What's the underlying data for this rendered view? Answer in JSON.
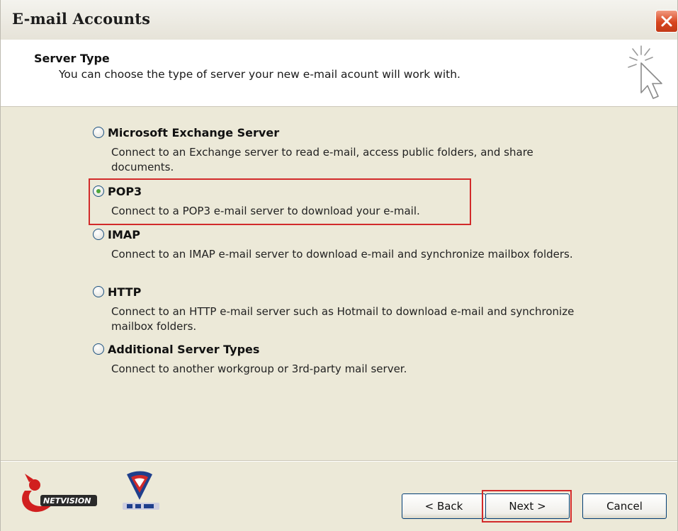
{
  "window": {
    "title": "E-mail Accounts"
  },
  "header": {
    "title": "Server Type",
    "subtitle": "You can choose the type of server your new e-mail acount will work with."
  },
  "options": [
    {
      "label": "Microsoft Exchange Server",
      "description": "Connect to an Exchange server to read e-mail, access public folders, and share documents.",
      "selected": false
    },
    {
      "label": "POP3",
      "description": "Connect to a POP3 e-mail server to download your e-mail.",
      "selected": true
    },
    {
      "label": "IMAP",
      "description": "Connect to an IMAP e-mail server to download e-mail and synchronize mailbox folders.",
      "selected": false
    },
    {
      "label": "HTTP",
      "description": "Connect to an HTTP e-mail server such as Hotmail to download e-mail and synchronize mailbox folders.",
      "selected": false
    },
    {
      "label": "Additional Server Types",
      "description": "Connect to another workgroup or 3rd-party mail server.",
      "selected": false
    }
  ],
  "footer": {
    "back_label": "< Back",
    "next_label": "Next >",
    "cancel_label": "Cancel"
  },
  "icons": {
    "close": "close-icon",
    "wizard": "wizard-cursor-icon",
    "logo_left": "netvision-logo",
    "logo_right": "pro-logo"
  },
  "colors": {
    "highlight": "#d22a2a",
    "close_button": "#d8461f",
    "radio_selected": "#4da63a"
  }
}
